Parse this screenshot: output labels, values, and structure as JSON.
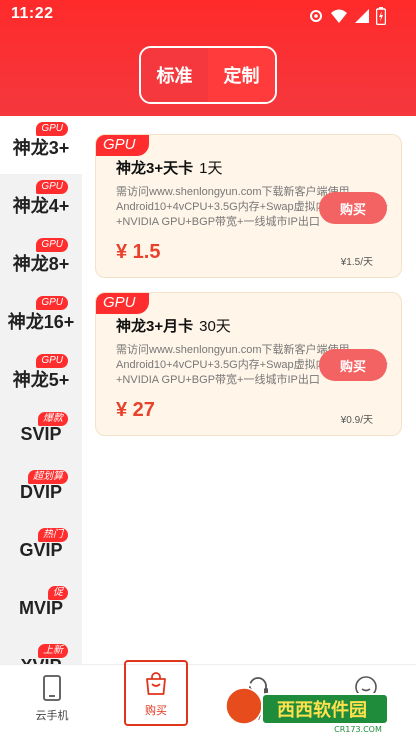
{
  "status_bar": {
    "time": "11:22"
  },
  "tabs": [
    {
      "label": "标准",
      "active": true
    },
    {
      "label": "定制",
      "active": false
    }
  ],
  "sidebar": {
    "items": [
      {
        "label": "神龙3+",
        "badge": "GPU",
        "active": true
      },
      {
        "label": "神龙4+",
        "badge": "GPU",
        "active": false
      },
      {
        "label": "神龙8+",
        "badge": "GPU",
        "active": false
      },
      {
        "label": "神龙16+",
        "badge": "GPU",
        "active": false
      },
      {
        "label": "神龙5+",
        "badge": "GPU",
        "active": false
      },
      {
        "label": "SVIP",
        "badge": "爆款",
        "active": false
      },
      {
        "label": "DVIP",
        "badge": "超划算",
        "active": false
      },
      {
        "label": "GVIP",
        "badge": "热门",
        "active": false
      },
      {
        "label": "MVIP",
        "badge": "促",
        "active": false
      },
      {
        "label": "XVIP",
        "badge": "上新",
        "active": false
      }
    ]
  },
  "cards": [
    {
      "tag": "GPU",
      "title": "神龙3+天卡",
      "duration": "1天",
      "description": "需访问www.shenlongyun.com下载新客户端使用Android10+4vCPU+3.5G内存+Swap虚拟内存+虚拟显卡+NVIDIA GPU+BGP带宽+一线城市IP出口",
      "price": "¥ 1.5",
      "unit_price": "¥1.5/天",
      "buy_label": "购买"
    },
    {
      "tag": "GPU",
      "title": "神龙3+月卡",
      "duration": "30天",
      "description": "需访问www.shenlongyun.com下载新客户端使用Android10+4vCPU+3.5G内存+Swap虚拟内存+虚拟显卡+NVIDIA GPU+BGP带宽+一线城市IP出口",
      "price": "¥ 27",
      "unit_price": "¥0.9/天",
      "buy_label": "购买"
    }
  ],
  "bottom_nav": [
    {
      "label": "云手机",
      "icon": "phone-icon"
    },
    {
      "label": "购买",
      "icon": "shopping-bag-icon",
      "selected": true
    },
    {
      "label": "客服",
      "icon": "headset-icon"
    },
    {
      "label": "我的",
      "icon": "user-icon"
    }
  ],
  "watermark": {
    "text": "西西软件园",
    "sub": "CR173.COM"
  },
  "colors": {
    "primary": "#f4383e",
    "card_bg": "#fff5e9",
    "price": "#e8412c",
    "buy_button": "#f46363"
  }
}
